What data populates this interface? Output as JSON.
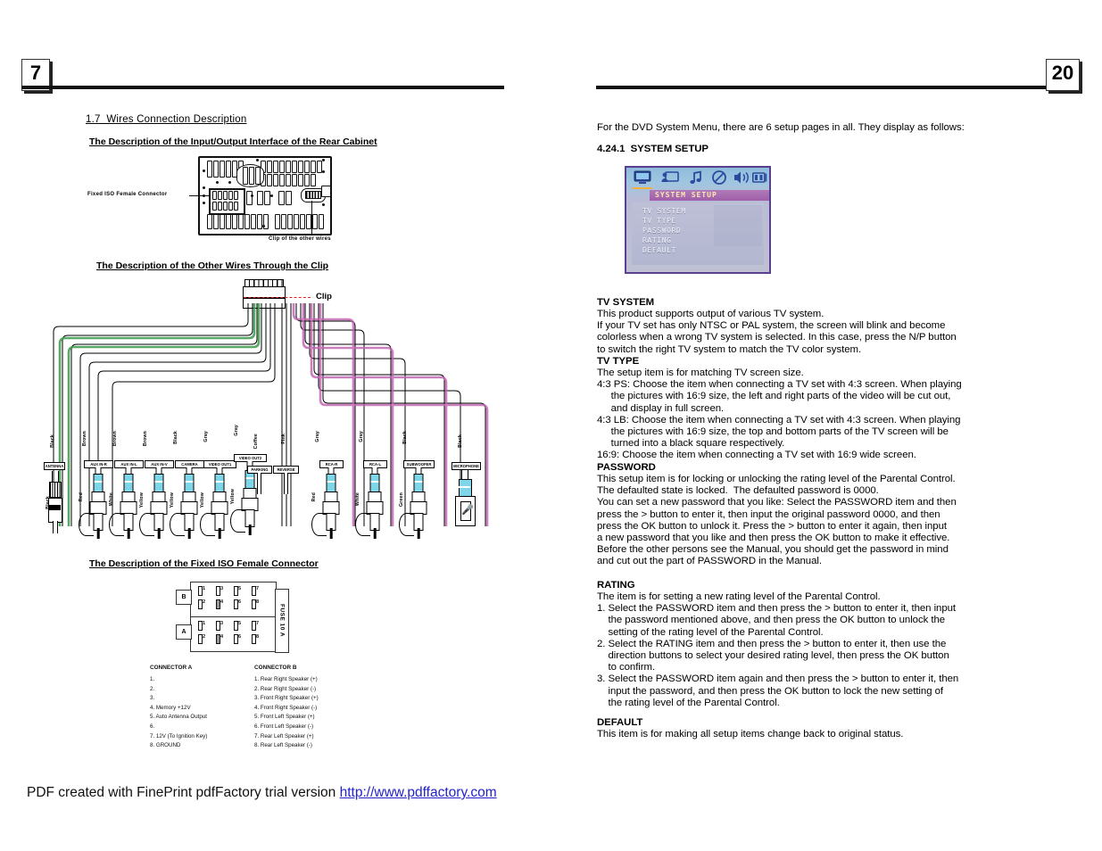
{
  "document": {
    "left_page_number": "7",
    "right_page_number": "20"
  },
  "left_page": {
    "section_heading": "1.7  Wires Connection Description",
    "sub_heading_1": "The Description of the Input/Output Interface of the Rear Cabinet",
    "rear_cabinet": {
      "label_iso": "Fixed ISO Female Connector",
      "label_clip": "Clip of the other wires"
    },
    "sub_heading_2": "The Description of the Other Wires Through the Clip",
    "clip_label": "Clip",
    "wires": [
      {
        "color": "Black",
        "tag": "ANTENNA",
        "plug": "Black"
      },
      {
        "color": "Brown",
        "tag": "AUX IN-R",
        "plug": "Red"
      },
      {
        "color": "Brown",
        "tag": "AUX IN-L",
        "plug": "White"
      },
      {
        "color": "Brown",
        "tag": "AUX IN-V",
        "plug": "Yellow"
      },
      {
        "color": "Black",
        "tag": "CAMERA",
        "plug": "Yellow"
      },
      {
        "color": "Gray",
        "tag": "VIDEO OUT1",
        "plug": "Yellow"
      },
      {
        "color": "Gray",
        "tag": "VIDEO OUT2",
        "plug": "Yellow"
      },
      {
        "color": "Coffee",
        "tag": "PARKING",
        "plug": ""
      },
      {
        "color": "Pink",
        "tag": "REVERSE",
        "plug": ""
      },
      {
        "color": "Gray",
        "tag": "RCA-R",
        "plug": "Red"
      },
      {
        "color": "Gray",
        "tag": "RCA-L",
        "plug": "White"
      },
      {
        "color": "Black",
        "tag": "SUBWOOFER",
        "plug": "Green"
      },
      {
        "color": "Black",
        "tag": "MICROPHONE",
        "plug": ""
      }
    ],
    "sub_heading_3": "The Description of the Fixed ISO Female Connector",
    "iso_connector": {
      "row_b_label": "B",
      "row_a_label": "A",
      "pins": [
        "1",
        "3",
        "5",
        "7",
        "2",
        "4",
        "6",
        "8"
      ],
      "fuse_label": "FUSE 10 A"
    },
    "connector_a": {
      "title": "CONNECTOR A",
      "items": [
        "1.",
        "2.",
        "3.",
        "4. Memory +12V",
        "5. Auto Antenna Output",
        "6.",
        "7. 12V (To Ignition Key)",
        "8. GROUND"
      ]
    },
    "connector_b": {
      "title": "CONNECTOR B",
      "items": [
        "1. Rear Right Speaker (+)",
        "2. Rear Right Speaker (-)",
        "3. Front Right Speaker (+)",
        "4. Front Right Speaker (-)",
        "5. Front Left Speaker (+)",
        "6. Front Left Speaker (-)",
        "7. Rear Left Speaker (+)",
        "8. Rear Left Speaker (-)"
      ]
    }
  },
  "right_page": {
    "intro": "For the DVD System Menu, there are 6 setup pages in all. They display as follows:",
    "section_number": "4.24.1  SYSTEM SETUP",
    "osd": {
      "title": "SYSTEM SETUP",
      "icons": [
        "monitor-icon",
        "video-setup-icon",
        "audio-note-icon",
        "disc-icon",
        "speaker-icon",
        "widescreen-icon"
      ],
      "items": [
        "TV SYSTEM",
        "TV TYPE",
        "PASSWORD",
        "RATING",
        "DEFAULT"
      ]
    },
    "blocks": [
      {
        "heading": "TV SYSTEM",
        "lines": [
          "This product supports output of various TV system.",
          "If your TV set has only NTSC or PAL system, the screen will blink and become",
          "colorless when a wrong TV system is selected. In this case, press the N/P button",
          "to switch the right TV system to match the TV color system."
        ]
      },
      {
        "heading": "TV TYPE",
        "lines": [
          "The setup item is for matching TV screen size.",
          "4:3 PS: Choose the item when connecting a TV set with 4:3 screen. When playing",
          "     the pictures with 16:9 size, the left and right parts of the video will be cut out,",
          "     and display in full screen.",
          "4:3 LB: Choose the item when connecting a TV set with 4:3 screen. When playing",
          "     the pictures with 16:9 size, the top and bottom parts of the TV screen will be",
          "     turned into a black square respectively.",
          "16:9: Choose the item when connecting a TV set with 16:9 wide screen."
        ]
      },
      {
        "heading": "PASSWORD",
        "lines": [
          "This setup item is for locking or unlocking the rating level of the Parental Control.",
          "The defaulted state is locked.  The defaulted password is 0000.",
          "You can set a new password that you like: Select the PASSWORD item and then",
          "press the > button to enter it, then input the original password 0000, and then",
          "press the OK button to unlock it. Press the > button to enter it again, then input",
          "a new password that you like and then press the OK button to make it effective.",
          "Before the other persons see the Manual, you should get the password in mind",
          "and cut out the part of PASSWORD in the Manual."
        ]
      },
      {
        "heading": "RATING",
        "lines": [
          "The item is for setting a new rating level of the Parental Control.",
          "1. Select the PASSWORD item and then press the > button to enter it, then input",
          "    the password mentioned above, and then press the OK button to unlock the",
          "    setting of the rating level of the Parental Control.",
          "2. Select the RATING item and then press the > button to enter it, then use the",
          "    direction buttons to select your desired rating level, then press the OK button",
          "    to confirm.",
          "3. Select the PASSWORD item again and then press the > button to enter it, then",
          "    input the password, and then press the OK button to lock the new setting of",
          "    the rating level of the Parental Control."
        ]
      },
      {
        "heading": "DEFAULT",
        "lines": [
          "This item is for making all setup items change back to original status."
        ]
      }
    ]
  },
  "footer": {
    "text": "PDF created with FinePrint pdfFactory trial version ",
    "link": "http://www.pdffactory.com"
  },
  "colors": {
    "rule": "#111111",
    "rca_band": "#7ed6e8",
    "osd_border": "#5a3f8f",
    "osd_title_bg": "#a05ea8",
    "osd_title_text": "#ffe9b0",
    "link": "#2222cc",
    "wire_green": "#3f9b4f",
    "wire_magenta": "#c060b0",
    "clip_red": "#dd2222"
  }
}
